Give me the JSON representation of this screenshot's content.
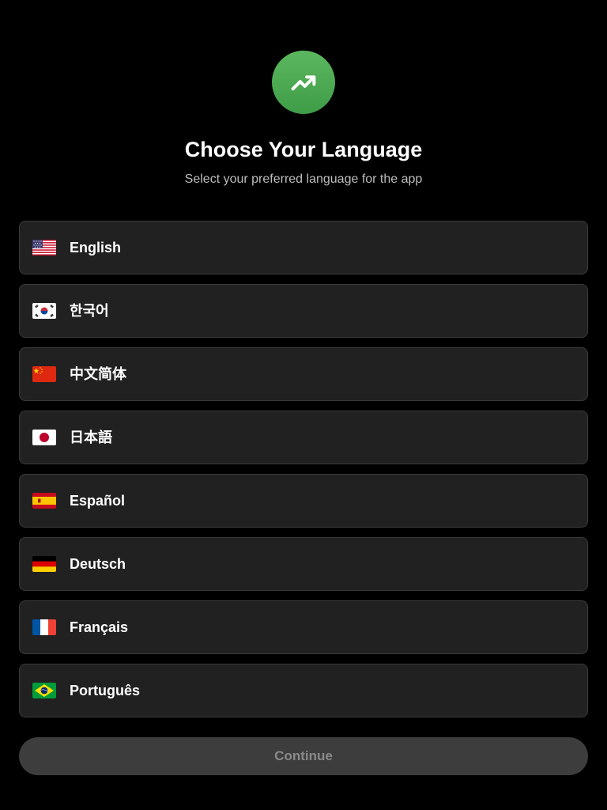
{
  "header": {
    "logo_icon": "trending-up-icon",
    "logo_color": "#4CAF50",
    "title": "Choose Your Language",
    "subtitle": "Select your preferred language for the app"
  },
  "languages": [
    {
      "flag": "us-flag-icon",
      "label": "English"
    },
    {
      "flag": "kr-flag-icon",
      "label": "한국어"
    },
    {
      "flag": "cn-flag-icon",
      "label": "中文简体"
    },
    {
      "flag": "jp-flag-icon",
      "label": "日本語"
    },
    {
      "flag": "es-flag-icon",
      "label": "Español"
    },
    {
      "flag": "de-flag-icon",
      "label": "Deutsch"
    },
    {
      "flag": "fr-flag-icon",
      "label": "Français"
    },
    {
      "flag": "br-flag-icon",
      "label": "Português"
    }
  ],
  "continue_button": {
    "label": "Continue",
    "state": "disabled"
  },
  "colors": {
    "background": "#000000",
    "card": "#212121",
    "card_border": "#3a3a3a",
    "button_disabled": "#3d3d3d",
    "button_text_disabled": "#8a8a8a"
  }
}
